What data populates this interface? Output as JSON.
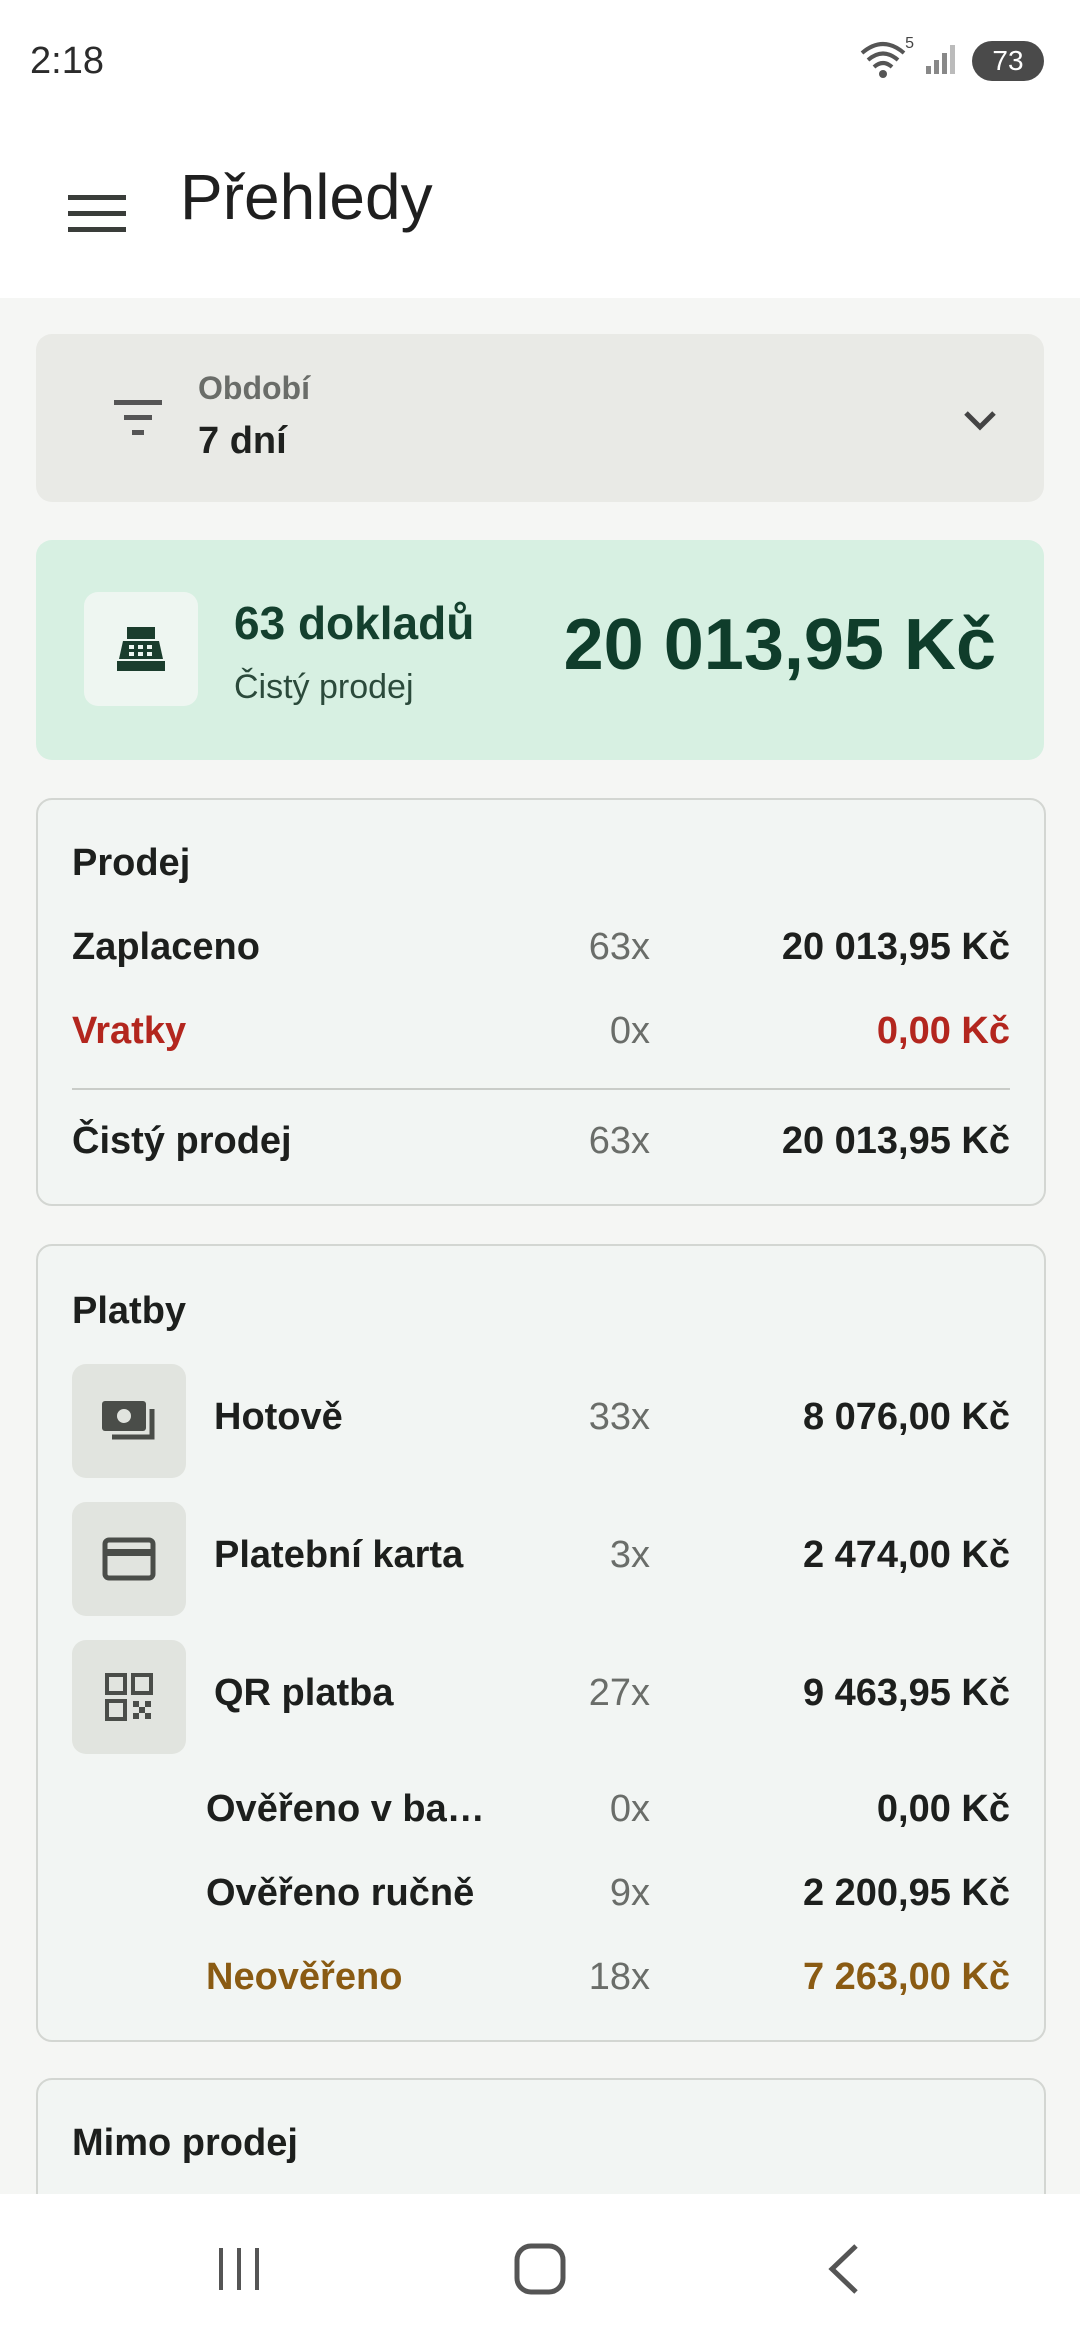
{
  "status": {
    "time": "2:18",
    "wifi_badge": "5",
    "battery": "73"
  },
  "appbar": {
    "title": "Přehledy"
  },
  "period": {
    "label": "Období",
    "value": "7 dní"
  },
  "summary": {
    "count": "63 dokladů",
    "subtitle": "Čistý prodej",
    "total": "20 013,95 Kč"
  },
  "sales": {
    "title": "Prodej",
    "rows": [
      {
        "name": "Zaplaceno",
        "qty": "63x",
        "amount": "20 013,95 Kč"
      },
      {
        "name": "Vratky",
        "qty": "0x",
        "amount": "0,00 Kč"
      },
      {
        "name": "Čistý prodej",
        "qty": "63x",
        "amount": "20 013,95 Kč"
      }
    ]
  },
  "payments": {
    "title": "Platby",
    "rows": [
      {
        "name": "Hotově",
        "qty": "33x",
        "amount": "8 076,00 Kč",
        "icon": "cash-icon"
      },
      {
        "name": "Platební karta",
        "qty": "3x",
        "amount": "2 474,00 Kč",
        "icon": "credit-card-icon"
      },
      {
        "name": "QR platba",
        "qty": "27x",
        "amount": "9 463,95 Kč",
        "icon": "qr-code-icon"
      }
    ],
    "sub_rows": [
      {
        "name": "Ověřeno v ba…",
        "qty": "0x",
        "amount": "0,00 Kč"
      },
      {
        "name": "Ověřeno ručně",
        "qty": "9x",
        "amount": "2 200,95 Kč"
      },
      {
        "name": "Neověřeno",
        "qty": "18x",
        "amount": "7 263,00 Kč"
      }
    ]
  },
  "other": {
    "title": "Mimo prodej"
  },
  "colors": {
    "summary_bg": "#d7f0e2",
    "refund_red": "#b3261e",
    "unverified_brown": "#8a5b13"
  }
}
